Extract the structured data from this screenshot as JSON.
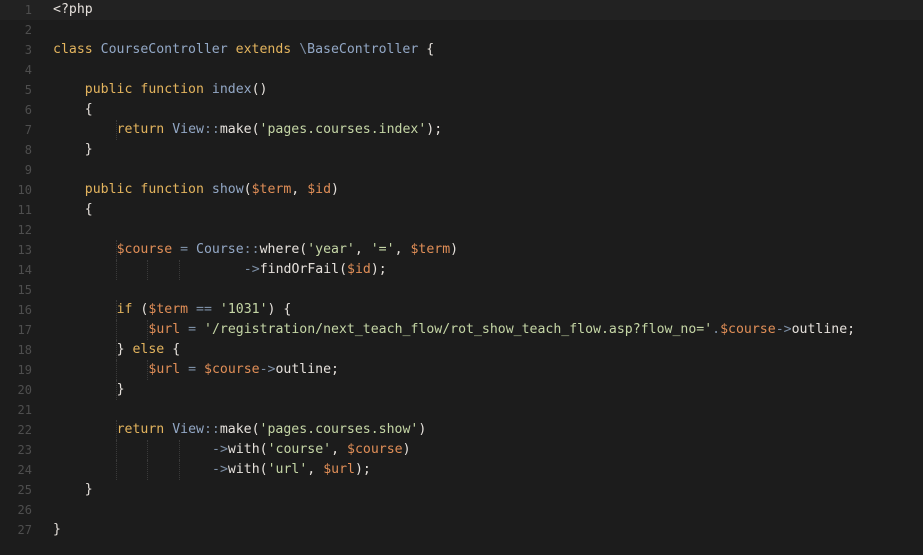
{
  "editor": {
    "language": "php",
    "colors": {
      "background": "#1c1c1c",
      "gutter_text": "#4e4e4e",
      "default_text": "#e6e1dc",
      "keyword": "#e3b45e",
      "class_name": "#93a8c6",
      "variable": "#e08e57",
      "string": "#c5d6a6",
      "operator": "#7d8fa6"
    },
    "lines": [
      {
        "n": "1",
        "indent": 0,
        "tokens": [
          [
            "plain",
            "<?php"
          ]
        ]
      },
      {
        "n": "2",
        "indent": 0,
        "tokens": []
      },
      {
        "n": "3",
        "indent": 0,
        "tokens": [
          [
            "kw",
            "class"
          ],
          [
            "plain",
            " "
          ],
          [
            "cls",
            "CourseController"
          ],
          [
            "plain",
            " "
          ],
          [
            "kw",
            "extends"
          ],
          [
            "plain",
            " "
          ],
          [
            "op",
            "\\"
          ],
          [
            "cls",
            "BaseController"
          ],
          [
            "plain",
            " {"
          ]
        ]
      },
      {
        "n": "4",
        "indent": 0,
        "tokens": []
      },
      {
        "n": "5",
        "indent": 1,
        "tokens": [
          [
            "kw",
            "public"
          ],
          [
            "plain",
            " "
          ],
          [
            "kw",
            "function"
          ],
          [
            "plain",
            " "
          ],
          [
            "fn",
            "index"
          ],
          [
            "plain",
            "()"
          ]
        ]
      },
      {
        "n": "6",
        "indent": 1,
        "tokens": [
          [
            "plain",
            "{"
          ]
        ]
      },
      {
        "n": "7",
        "indent": 2,
        "tokens": [
          [
            "kw",
            "return"
          ],
          [
            "plain",
            " "
          ],
          [
            "cls",
            "View"
          ],
          [
            "op",
            "::"
          ],
          [
            "plain",
            "make("
          ],
          [
            "str",
            "'pages.courses.index'"
          ],
          [
            "plain",
            ");"
          ]
        ]
      },
      {
        "n": "8",
        "indent": 1,
        "tokens": [
          [
            "plain",
            "}"
          ]
        ]
      },
      {
        "n": "9",
        "indent": 0,
        "tokens": []
      },
      {
        "n": "10",
        "indent": 1,
        "tokens": [
          [
            "kw",
            "public"
          ],
          [
            "plain",
            " "
          ],
          [
            "kw",
            "function"
          ],
          [
            "plain",
            " "
          ],
          [
            "fn",
            "show"
          ],
          [
            "plain",
            "("
          ],
          [
            "var",
            "$term"
          ],
          [
            "plain",
            ", "
          ],
          [
            "var",
            "$id"
          ],
          [
            "plain",
            ")"
          ]
        ]
      },
      {
        "n": "11",
        "indent": 1,
        "tokens": [
          [
            "plain",
            "{"
          ]
        ]
      },
      {
        "n": "12",
        "indent": 0,
        "tokens": []
      },
      {
        "n": "13",
        "indent": 2,
        "tokens": [
          [
            "var",
            "$course"
          ],
          [
            "plain",
            " "
          ],
          [
            "op",
            "="
          ],
          [
            "plain",
            " "
          ],
          [
            "cls",
            "Course"
          ],
          [
            "op",
            "::"
          ],
          [
            "plain",
            "where("
          ],
          [
            "str",
            "'year'"
          ],
          [
            "plain",
            ", "
          ],
          [
            "str",
            "'='"
          ],
          [
            "plain",
            ", "
          ],
          [
            "var",
            "$term"
          ],
          [
            "plain",
            ")"
          ]
        ]
      },
      {
        "n": "14",
        "indent": 6,
        "tokens": [
          [
            "op",
            "->"
          ],
          [
            "plain",
            "findOrFail("
          ],
          [
            "var",
            "$id"
          ],
          [
            "plain",
            ");"
          ]
        ]
      },
      {
        "n": "15",
        "indent": 0,
        "tokens": []
      },
      {
        "n": "16",
        "indent": 2,
        "tokens": [
          [
            "kw",
            "if"
          ],
          [
            "plain",
            " ("
          ],
          [
            "var",
            "$term"
          ],
          [
            "plain",
            " "
          ],
          [
            "op",
            "=="
          ],
          [
            "plain",
            " "
          ],
          [
            "str",
            "'1031'"
          ],
          [
            "plain",
            ") {"
          ]
        ]
      },
      {
        "n": "17",
        "indent": 3,
        "tokens": [
          [
            "var",
            "$url"
          ],
          [
            "plain",
            " "
          ],
          [
            "op",
            "="
          ],
          [
            "plain",
            " "
          ],
          [
            "str",
            "'/registration/next_teach_flow/rot_show_teach_flow.asp?flow_no='"
          ],
          [
            "op",
            "."
          ],
          [
            "var",
            "$course"
          ],
          [
            "op",
            "->"
          ],
          [
            "plain",
            "outline;"
          ]
        ]
      },
      {
        "n": "18",
        "indent": 2,
        "tokens": [
          [
            "plain",
            "} "
          ],
          [
            "kw",
            "else"
          ],
          [
            "plain",
            " {"
          ]
        ]
      },
      {
        "n": "19",
        "indent": 3,
        "tokens": [
          [
            "var",
            "$url"
          ],
          [
            "plain",
            " "
          ],
          [
            "op",
            "="
          ],
          [
            "plain",
            " "
          ],
          [
            "var",
            "$course"
          ],
          [
            "op",
            "->"
          ],
          [
            "plain",
            "outline;"
          ]
        ]
      },
      {
        "n": "20",
        "indent": 2,
        "tokens": [
          [
            "plain",
            "}"
          ]
        ]
      },
      {
        "n": "21",
        "indent": 0,
        "tokens": []
      },
      {
        "n": "22",
        "indent": 2,
        "tokens": [
          [
            "kw",
            "return"
          ],
          [
            "plain",
            " "
          ],
          [
            "cls",
            "View"
          ],
          [
            "op",
            "::"
          ],
          [
            "plain",
            "make("
          ],
          [
            "str",
            "'pages.courses.show'"
          ],
          [
            "plain",
            ")"
          ]
        ]
      },
      {
        "n": "23",
        "indent": 5,
        "tokens": [
          [
            "op",
            "->"
          ],
          [
            "plain",
            "with("
          ],
          [
            "str",
            "'course'"
          ],
          [
            "plain",
            ", "
          ],
          [
            "var",
            "$course"
          ],
          [
            "plain",
            ")"
          ]
        ]
      },
      {
        "n": "24",
        "indent": 5,
        "tokens": [
          [
            "op",
            "->"
          ],
          [
            "plain",
            "with("
          ],
          [
            "str",
            "'url'"
          ],
          [
            "plain",
            ", "
          ],
          [
            "var",
            "$url"
          ],
          [
            "plain",
            ");"
          ]
        ]
      },
      {
        "n": "25",
        "indent": 1,
        "tokens": [
          [
            "plain",
            "}"
          ]
        ]
      },
      {
        "n": "26",
        "indent": 0,
        "tokens": []
      },
      {
        "n": "27",
        "indent": 0,
        "tokens": [
          [
            "plain",
            "}"
          ]
        ]
      }
    ]
  }
}
